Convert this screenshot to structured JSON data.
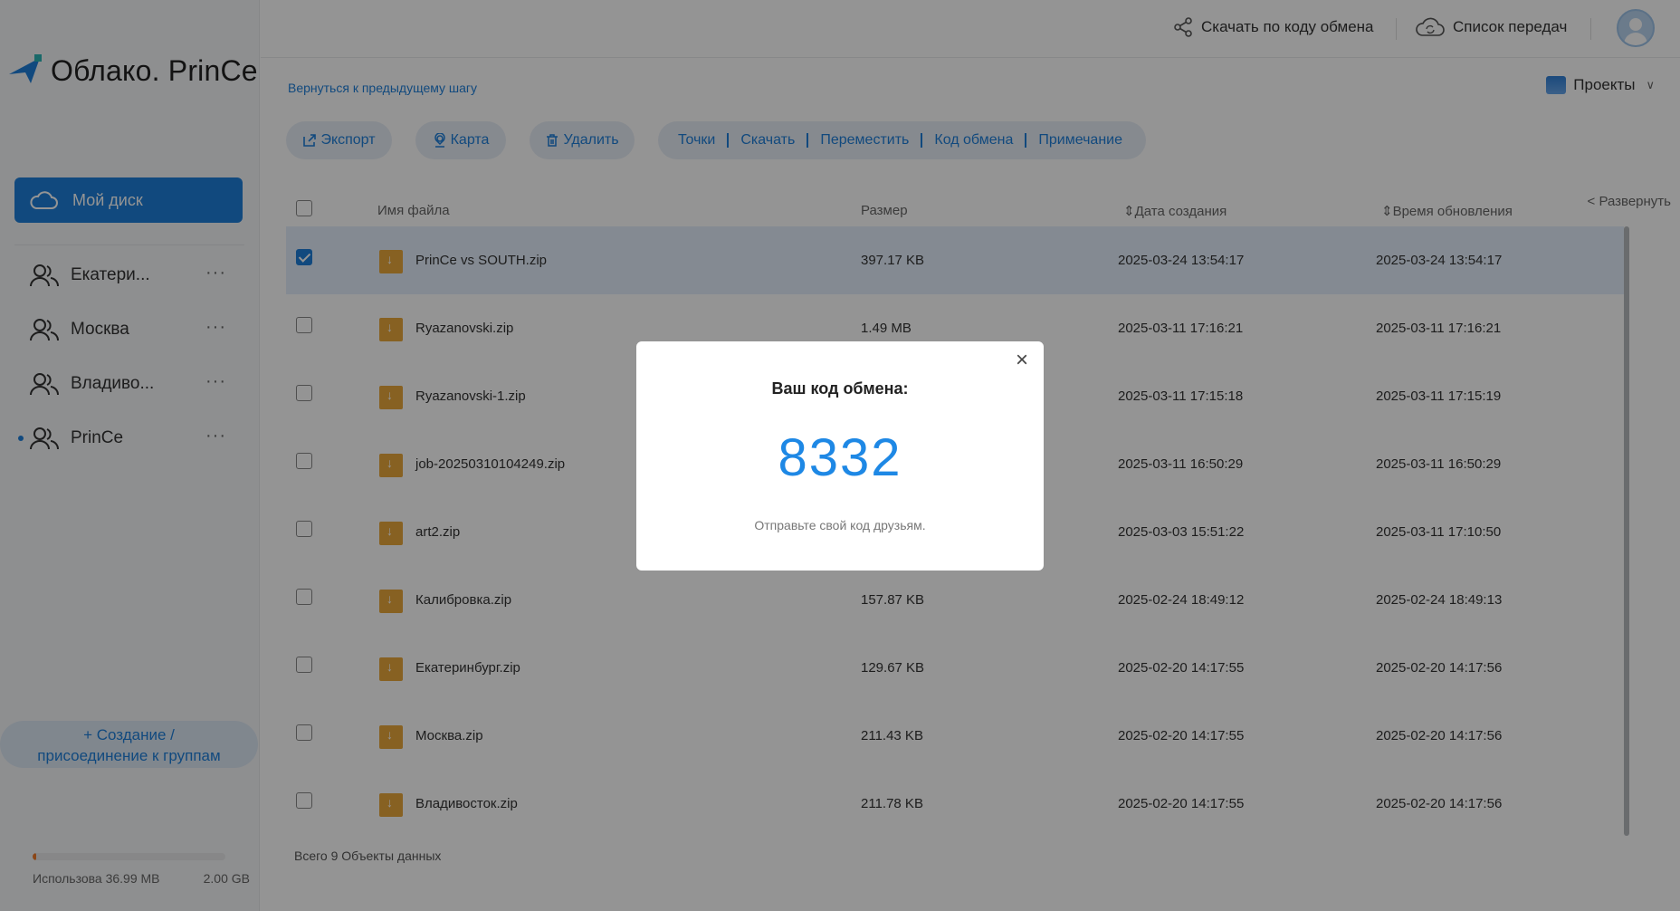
{
  "sidebar": {
    "logo_text": "Облако. PrinCe",
    "my_disk": "Мой диск",
    "groups": [
      {
        "label": "Екатери..."
      },
      {
        "label": "Москва"
      },
      {
        "label": "Владиво..."
      },
      {
        "label": "PrinCe"
      }
    ],
    "more_label": "···",
    "create_group_line1": "+ Создание /",
    "create_group_line2": "присоединение к группам",
    "storage_used": "Использова 36.99 MB",
    "storage_total": "2.00 GB",
    "storage_fraction": 0.018
  },
  "header": {
    "download_by_code": "Скачать по коду обмена",
    "transfer_list": "Список передач"
  },
  "nav": {
    "back": "Вернуться к предыдущему шагу",
    "projects": "Проекты"
  },
  "toolbar": {
    "export": "Экспорт",
    "map": "Карта",
    "delete": "Удалить",
    "points": "Точки",
    "download": "Скачать",
    "move": "Переместить",
    "exchange_code": "Код обмена",
    "note": "Примечание"
  },
  "table": {
    "col_name": "Имя файла",
    "col_size": "Размер",
    "col_created": "Дата создания",
    "col_updated": "Время обновления",
    "expand": "< Развернуть",
    "rows": [
      {
        "name": "PrinCe vs SOUTH.zip",
        "size": "397.17 KB",
        "created": "2025-03-24 13:54:17",
        "updated": "2025-03-24 13:54:17",
        "checked": true
      },
      {
        "name": "Ryazanovski.zip",
        "size": "1.49 MB",
        "created": "2025-03-11 17:16:21",
        "updated": "2025-03-11 17:16:21",
        "checked": false
      },
      {
        "name": "Ryazanovski-1.zip",
        "size": "",
        "created": "2025-03-11 17:15:18",
        "updated": "2025-03-11 17:15:19",
        "checked": false
      },
      {
        "name": "job-20250310104249.zip",
        "size": "",
        "created": "2025-03-11 16:50:29",
        "updated": "2025-03-11 16:50:29",
        "checked": false
      },
      {
        "name": "art2.zip",
        "size": "",
        "created": "2025-03-03 15:51:22",
        "updated": "2025-03-11 17:10:50",
        "checked": false
      },
      {
        "name": "Калибровка.zip",
        "size": "157.87 KB",
        "created": "2025-02-24 18:49:12",
        "updated": "2025-02-24 18:49:13",
        "checked": false
      },
      {
        "name": "Екатеринбург.zip",
        "size": "129.67 KB",
        "created": "2025-02-20 14:17:55",
        "updated": "2025-02-20 14:17:56",
        "checked": false
      },
      {
        "name": "Москва.zip",
        "size": "211.43 KB",
        "created": "2025-02-20 14:17:55",
        "updated": "2025-02-20 14:17:56",
        "checked": false
      },
      {
        "name": "Владивосток.zip",
        "size": "211.78 KB",
        "created": "2025-02-20 14:17:55",
        "updated": "2025-02-20 14:17:56",
        "checked": false
      }
    ],
    "total": "Всего 9 Объекты данных"
  },
  "modal": {
    "title": "Ваш код обмена:",
    "code": "8332",
    "hint": "Отправьте свой код друзьям."
  },
  "colors": {
    "accent": "#1e7fd9",
    "file_icon": "#e9a83c",
    "overlay": "rgba(0,0,0,0.42)"
  }
}
